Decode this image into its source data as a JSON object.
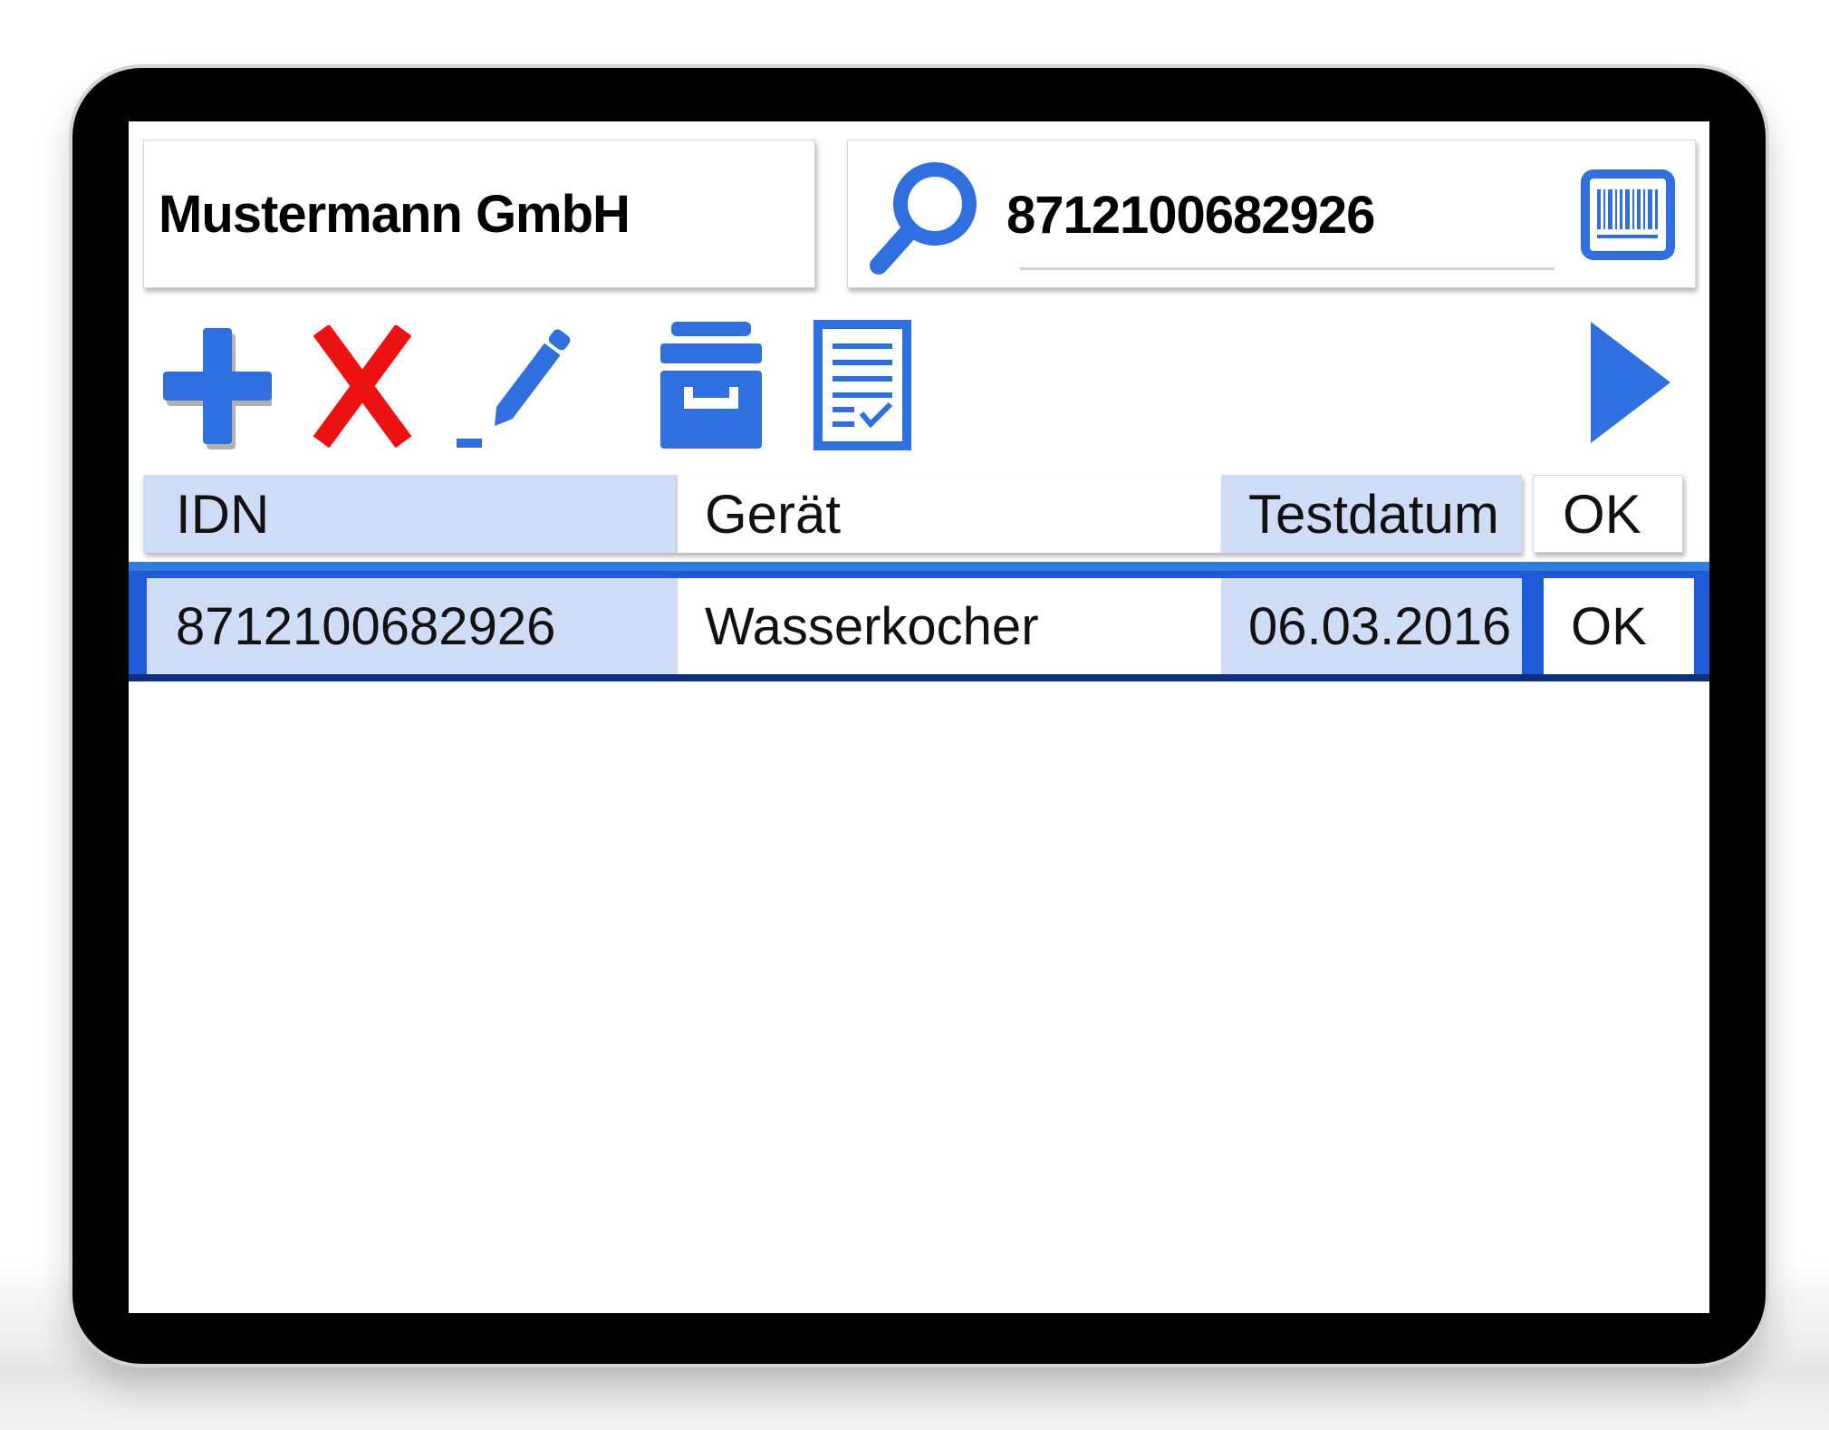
{
  "company": {
    "name": "Mustermann GmbH"
  },
  "search": {
    "value": "8712100682926"
  },
  "toolbar": {
    "buttons": [
      {
        "name": "add",
        "icon": "plus-icon",
        "color": "#2f6fe0"
      },
      {
        "name": "delete",
        "icon": "close-icon",
        "color": "#ee1111"
      },
      {
        "name": "edit",
        "icon": "pencil-icon",
        "color": "#2f6fe0"
      },
      {
        "name": "archive",
        "icon": "archive-box-icon",
        "color": "#2f6fe0"
      },
      {
        "name": "report",
        "icon": "checklist-document-icon",
        "color": "#2f6fe0"
      },
      {
        "name": "next",
        "icon": "play-arrow-icon",
        "color": "#2f6fe0"
      }
    ]
  },
  "table": {
    "columns": [
      "IDN",
      "Gerät",
      "Testdatum",
      "OK"
    ],
    "rows": [
      {
        "idn": "8712100682926",
        "geraet": "Wasserkocher",
        "testdatum": "06.03.2016",
        "ok": "OK",
        "selected": true
      }
    ]
  },
  "colors": {
    "accent": "#2f6fe0",
    "column_highlight": "#cfdcf6",
    "selection": "#1f5bd6",
    "delete": "#ee1111"
  }
}
